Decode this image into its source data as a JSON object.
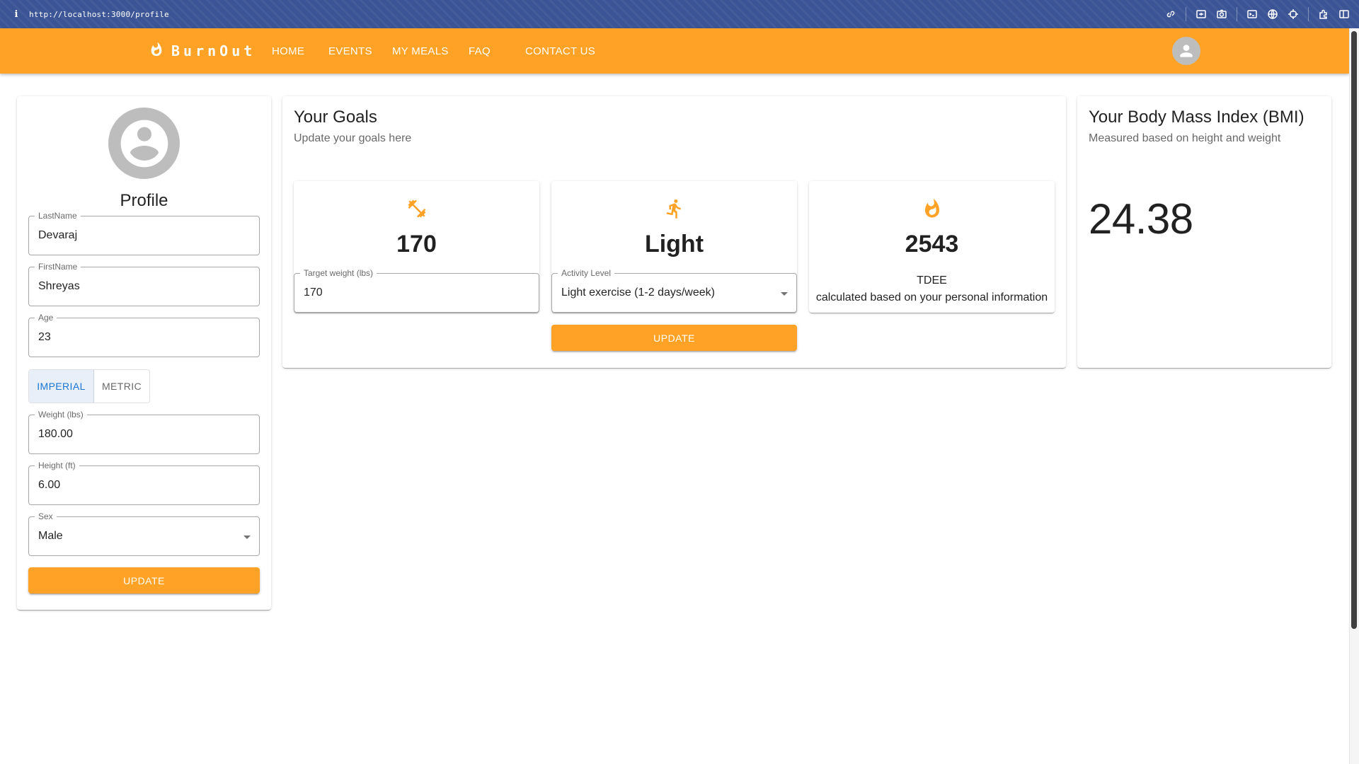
{
  "browser": {
    "url": "http://localhost:3000/profile",
    "icons": [
      "link-icon",
      "screen-capture-icon",
      "camera-icon",
      "terminal-icon",
      "globe-icon",
      "crosshair-icon",
      "extensions-icon",
      "sidebar-icon"
    ]
  },
  "navbar": {
    "brand": "BurnOut",
    "items": [
      "HOME",
      "EVENTS",
      "MY MEALS",
      "FAQ",
      "CONTACT US"
    ],
    "accent_color": "#ffa226"
  },
  "profile": {
    "title": "Profile",
    "fields": {
      "last_name": {
        "label": "LastName",
        "value": "Devaraj"
      },
      "first_name": {
        "label": "FirstName",
        "value": "Shreyas"
      },
      "age": {
        "label": "Age",
        "value": "23"
      },
      "weight": {
        "label": "Weight (lbs)",
        "value": "180.00"
      },
      "height": {
        "label": "Height (ft)",
        "value": "6.00"
      },
      "sex": {
        "label": "Sex",
        "value": "Male"
      }
    },
    "units": {
      "options": [
        "IMPERIAL",
        "METRIC"
      ],
      "selected": "IMPERIAL"
    },
    "update_label": "UPDATE"
  },
  "goals": {
    "title": "Your Goals",
    "subtitle": "Update your goals here",
    "target_weight": {
      "value": "170",
      "label": "Target weight (lbs)",
      "field_value": "170",
      "icon": "dumbbell-icon"
    },
    "activity": {
      "value": "Light",
      "label": "Activity Level",
      "field_value": "Light exercise (1-2 days/week)",
      "icon": "running-icon"
    },
    "tdee": {
      "value": "2543",
      "label": "TDEE",
      "description": "calculated based on your personal information",
      "icon": "flame-icon"
    },
    "update_label": "UPDATE"
  },
  "bmi": {
    "title": "Your Body Mass Index (BMI)",
    "subtitle": "Measured based on height and weight",
    "value": "24.38"
  }
}
